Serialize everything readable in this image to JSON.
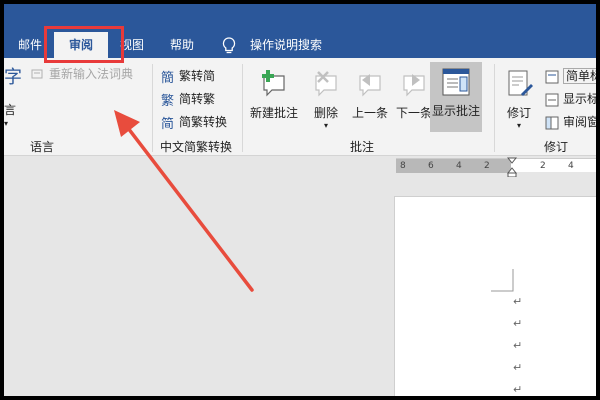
{
  "tabs": [
    {
      "label": "邮件"
    },
    {
      "label": "审阅"
    },
    {
      "label": "视图"
    },
    {
      "label": "帮助"
    },
    {
      "label": "操作说明搜索"
    }
  ],
  "ribbon": {
    "language": {
      "partial_top": "字",
      "partial_bottom": "言",
      "disabled_item": "重新输入法词典",
      "group_label": "语言"
    },
    "chinese": {
      "items": [
        "繁转简",
        "简转繁",
        "简繁转换"
      ],
      "group_label": "中文简繁转换"
    },
    "comments": {
      "new": "新建批注",
      "delete": "删除",
      "prev": "上一条",
      "next": "下一条",
      "show": "显示批注",
      "group_label": "批注"
    },
    "tracking": {
      "track": "修订",
      "markup": "简单标",
      "show_markup": "显示标",
      "reviewing_pane": "审阅窗",
      "group_label": "修订"
    }
  },
  "ruler": {
    "ticks": [
      "8",
      "6",
      "4",
      "2",
      "2",
      "4"
    ]
  },
  "document": {
    "paragraph_mark": "↵"
  },
  "colors": {
    "titlebar": "#2b579a",
    "highlight_box": "#e83a3a",
    "arrow": "#e84c3d"
  }
}
